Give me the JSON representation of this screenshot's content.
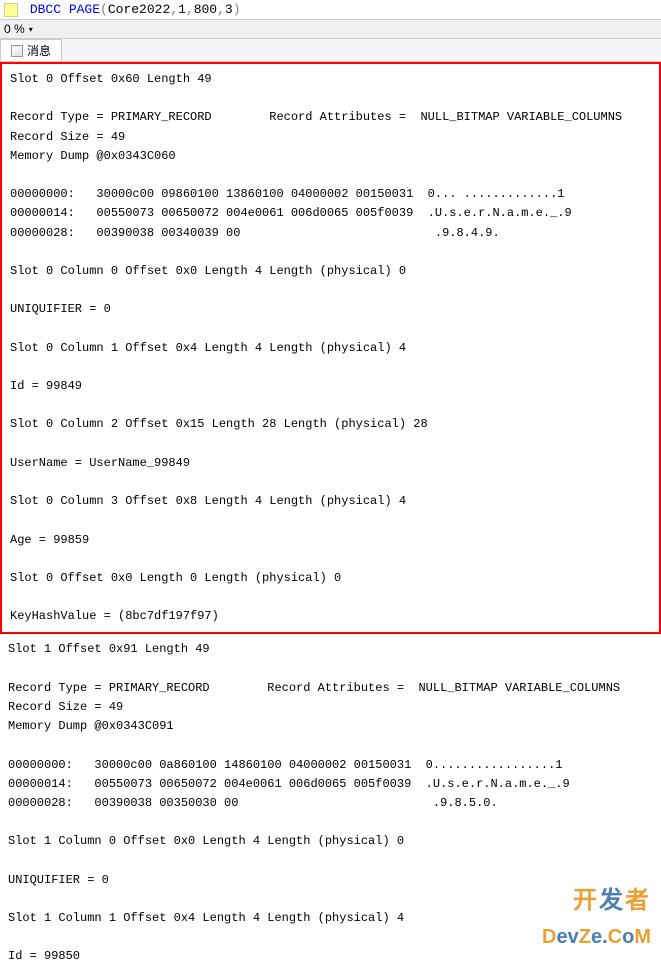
{
  "sql": {
    "keyword": "DBCC PAGE",
    "arg_db": "Core2022",
    "arg_fileno": "1",
    "arg_pageno": "800",
    "arg_opt": "3"
  },
  "status": {
    "percent": "0 %"
  },
  "tab": {
    "label": "消息"
  },
  "slot0": {
    "header": "Slot 0 Offset 0x60 Length 49",
    "record_type": "Record Type = PRIMARY_RECORD        Record Attributes =  NULL_BITMAP VARIABLE_COLUMNS",
    "record_size": "Record Size = 49",
    "memory_dump": "Memory Dump @0x0343C060",
    "hex0": "00000000:   30000c00 09860100 13860100 04000002 00150031  0... .............1",
    "hex1": "00000014:   00550073 00650072 004e0061 006d0065 005f0039  .U.s.e.r.N.a.m.e._.9",
    "hex2": "00000028:   00390038 00340039 00                           .9.8.4.9.",
    "col0": "Slot 0 Column 0 Offset 0x0 Length 4 Length (physical) 0",
    "uniquifier": "UNIQUIFIER = 0",
    "col1": "Slot 0 Column 1 Offset 0x4 Length 4 Length (physical) 4",
    "id": "Id = 99849",
    "col2": "Slot 0 Column 2 Offset 0x15 Length 28 Length (physical) 28",
    "username": "UserName = UserName_99849",
    "col3": "Slot 0 Column 3 Offset 0x8 Length 4 Length (physical) 4",
    "age": "Age = 99859",
    "col4": "Slot 0 Offset 0x0 Length 0 Length (physical) 0",
    "keyhash": "KeyHashValue = (8bc7df197f97)"
  },
  "slot1": {
    "header": "Slot 1 Offset 0x91 Length 49",
    "record_type": "Record Type = PRIMARY_RECORD        Record Attributes =  NULL_BITMAP VARIABLE_COLUMNS",
    "record_size": "Record Size = 49",
    "memory_dump": "Memory Dump @0x0343C091",
    "hex0": "00000000:   30000c00 0a860100 14860100 04000002 00150031  0.................1",
    "hex1": "00000014:   00550073 00650072 004e0061 006d0065 005f0039  .U.s.e.r.N.a.m.e._.9",
    "hex2": "00000028:   00390038 00350030 00                           .9.8.5.0.",
    "col0": "Slot 1 Column 0 Offset 0x0 Length 4 Length (physical) 0",
    "uniquifier": "UNIQUIFIER = 0",
    "col1": "Slot 1 Column 1 Offset 0x4 Length 4 Length (physical) 4",
    "id": "Id = 99850"
  },
  "watermark": {
    "line1a": "开",
    "line1b": "发",
    "line1c": "者",
    "line2a": "D",
    "line2b": "ev",
    "line2c": "Z",
    "line2d": "e.",
    "line2e": "C",
    "line2f": "o",
    "line2g": "M"
  }
}
